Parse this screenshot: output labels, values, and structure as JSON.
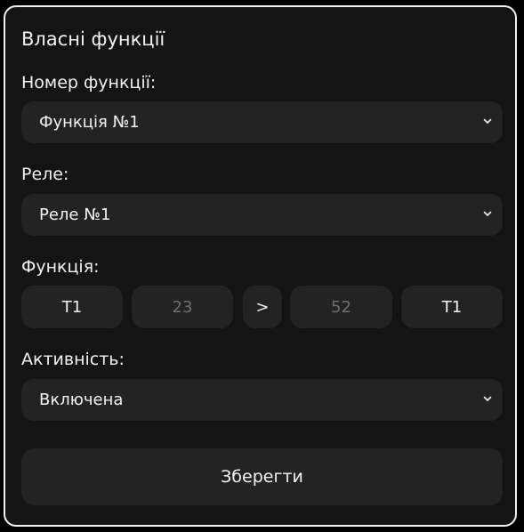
{
  "panel": {
    "title": "Власні функції"
  },
  "function_number": {
    "label": "Номер функції:",
    "value": "Функція №1"
  },
  "relay": {
    "label": "Реле:",
    "value": "Реле №1"
  },
  "function": {
    "label": "Функція:",
    "left_sensor": "T1",
    "value_a": "23",
    "operator": ">",
    "value_b": "52",
    "right_sensor": "T1"
  },
  "activity": {
    "label": "Активність:",
    "value": "Включена"
  },
  "save_label": "Зберегти",
  "colors": {
    "background": "#000000",
    "panel": "#141414",
    "control": "#232323",
    "text": "#f2f2f2",
    "muted_text": "#6f6f6f",
    "border": "#f2f2f2"
  },
  "icons": {
    "dropdown": "chevron-down-icon"
  }
}
